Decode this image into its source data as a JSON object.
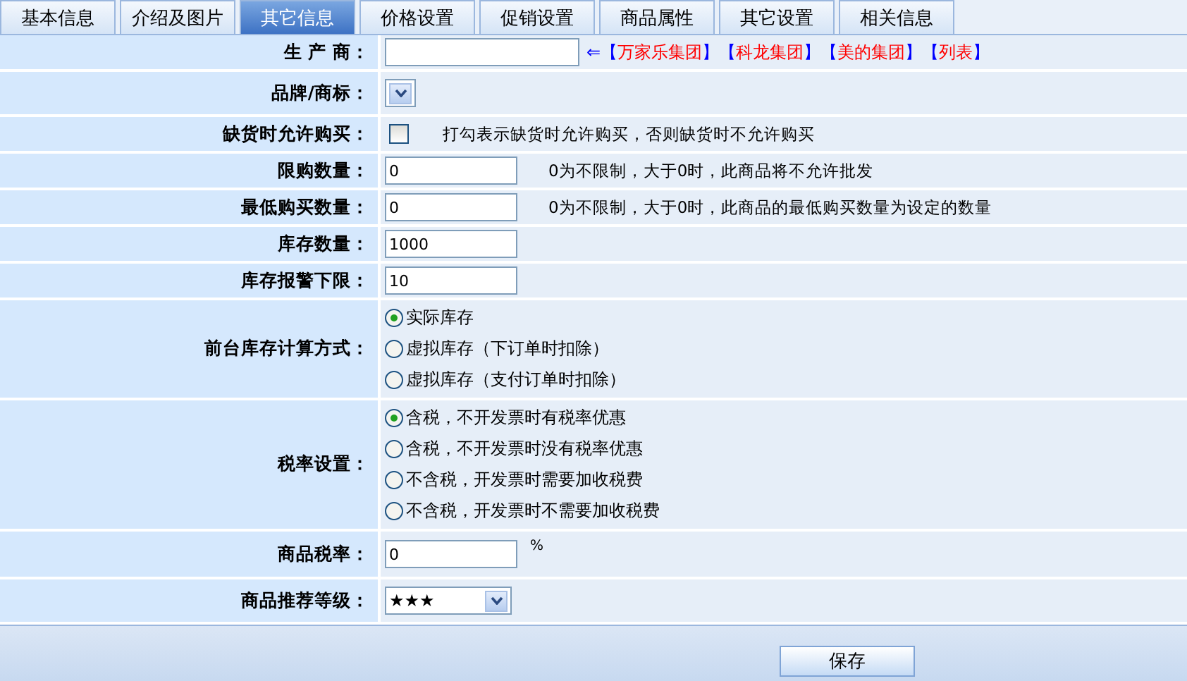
{
  "tabs": [
    {
      "label": "基本信息",
      "selected": false
    },
    {
      "label": "介绍及图片",
      "selected": false
    },
    {
      "label": "其它信息",
      "selected": true
    },
    {
      "label": "价格设置",
      "selected": false
    },
    {
      "label": "促销设置",
      "selected": false
    },
    {
      "label": "商品属性",
      "selected": false
    },
    {
      "label": "其它设置",
      "selected": false
    },
    {
      "label": "相关信息",
      "selected": false
    }
  ],
  "rows": [
    {
      "kind": "picker",
      "label": "生 产 商：",
      "value": "",
      "arrow": "⇐",
      "links": [
        {
          "open": "【",
          "name": "万家乐集团",
          "close": "】"
        },
        {
          "open": "【",
          "name": "科龙集团",
          "close": "】"
        },
        {
          "open": "【",
          "name": "美的集团",
          "close": "】"
        },
        {
          "open": "【",
          "name": "列表",
          "close": "】"
        }
      ]
    },
    {
      "kind": "select",
      "label": "品牌/商标：",
      "value": ""
    },
    {
      "kind": "checkbox",
      "label": "缺货时允许购买：",
      "checked": false,
      "hint": "打勾表示缺货时允许购买，否则缺货时不允许购买"
    },
    {
      "kind": "text",
      "label": "限购数量：",
      "value": "0",
      "hint": "0为不限制，大于0时，此商品将不允许批发"
    },
    {
      "kind": "text",
      "label": "最低购买数量：",
      "value": "0",
      "hint": "0为不限制，大于0时，此商品的最低购买数量为设定的数量"
    },
    {
      "kind": "text",
      "label": "库存数量：",
      "value": "1000"
    },
    {
      "kind": "text",
      "label": "库存报警下限：",
      "value": "10"
    },
    {
      "kind": "radio",
      "label": "前台库存计算方式：",
      "options": [
        {
          "label": "实际库存",
          "selected": true
        },
        {
          "label": "虚拟库存（下订单时扣除）",
          "selected": false
        },
        {
          "label": "虚拟库存（支付订单时扣除）",
          "selected": false
        }
      ]
    },
    {
      "kind": "radio",
      "label": "税率设置：",
      "options": [
        {
          "label": "含税，不开发票时有税率优惠",
          "selected": true
        },
        {
          "label": "含税，不开发票时没有税率优惠",
          "selected": false
        },
        {
          "label": "不含税，开发票时需要加收税费",
          "selected": false
        },
        {
          "label": "不含税，开发票时不需要加收税费",
          "selected": false
        }
      ]
    },
    {
      "kind": "text",
      "label": "商品税率：",
      "value": "0",
      "hint": "%"
    },
    {
      "kind": "select",
      "label": "商品推荐等级：",
      "value": "★★★"
    }
  ],
  "save_button": "保存"
}
